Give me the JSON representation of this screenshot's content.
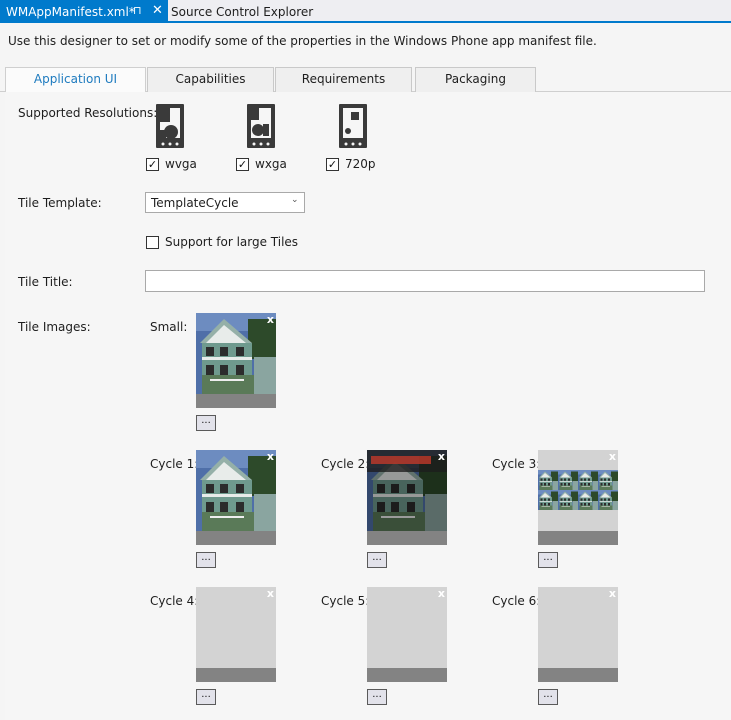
{
  "doc_tabs": {
    "active_label": "WMAppManifest.xml*",
    "inactive_label": "Source Control Explorer"
  },
  "intro": "Use this designer to set or modify some of the properties in the Windows Phone app manifest file.",
  "tabs": [
    {
      "label": "Application UI",
      "active": true
    },
    {
      "label": "Capabilities"
    },
    {
      "label": "Requirements"
    },
    {
      "label": "Packaging"
    }
  ],
  "labels": {
    "supported_resolutions": "Supported Resolutions:",
    "tile_template": "Tile Template:",
    "tile_title": "Tile Title:",
    "tile_images": "Tile Images:"
  },
  "resolutions": [
    {
      "label": "wvga",
      "checked": true,
      "icon": "phone-wvga-icon"
    },
    {
      "label": "wxga",
      "checked": true,
      "icon": "phone-wxga-icon"
    },
    {
      "label": "720p",
      "checked": true,
      "icon": "phone-720p-icon"
    }
  ],
  "tile_template": {
    "value": "TemplateCycle"
  },
  "large_tiles": {
    "label": "Support for large Tiles",
    "checked": false
  },
  "tile_title": {
    "value": ""
  },
  "browse_label": "...",
  "tile_images": [
    {
      "label": "Small:",
      "image": "house"
    },
    {
      "label": "Cycle 1:",
      "image": "house"
    },
    {
      "label": "Cycle 2:",
      "image": "house-dark"
    },
    {
      "label": "Cycle 3:",
      "image": "house-tiled"
    },
    {
      "label": "Cycle 4:",
      "image": "empty"
    },
    {
      "label": "Cycle 5:",
      "image": "empty"
    },
    {
      "label": "Cycle 6:",
      "image": "empty"
    }
  ],
  "close_glyph": "x",
  "check_glyph": "✓",
  "pin_glyph": "⊓",
  "tab_close_glyph": "✕",
  "dropdown_glyph": "⌄"
}
